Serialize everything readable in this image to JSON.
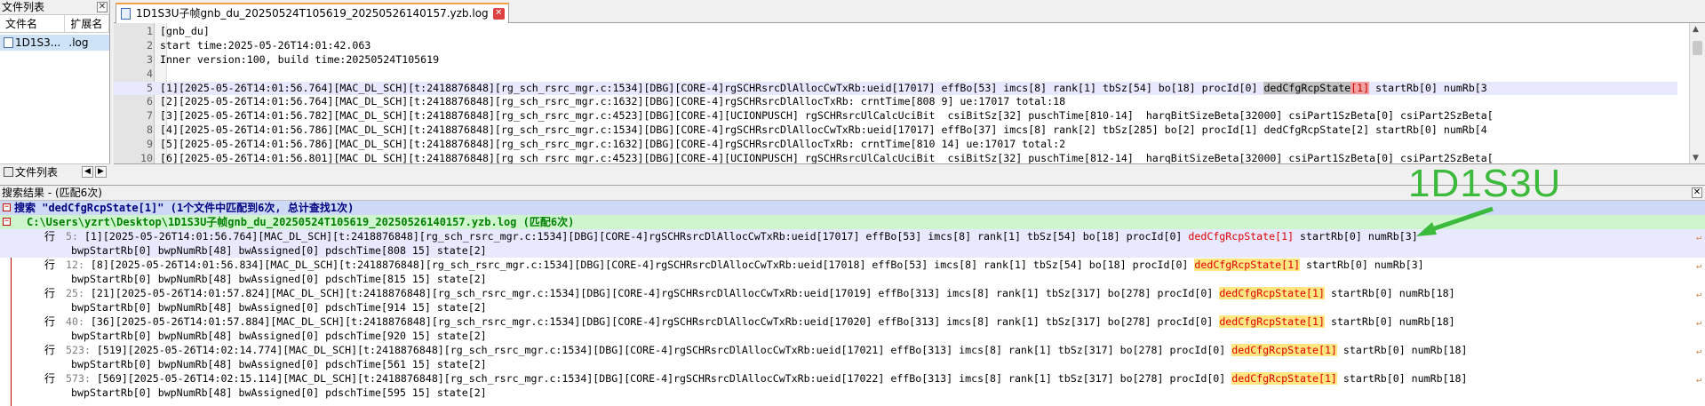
{
  "file_list_panel": {
    "title": "文件列表",
    "columns": [
      "文件名",
      "扩展名"
    ],
    "rows": [
      {
        "name": "1D1S3...",
        "ext": ".log"
      }
    ],
    "bottom_tab": "文件列表"
  },
  "editor": {
    "tab_title": "1D1S3U子帧gnb_du_20250524T105619_20250526140157.yzb.log",
    "lines": [
      {
        "n": "1",
        "t": "[gnb_du]"
      },
      {
        "n": "2",
        "t": "start time:2025-05-26T14:01:42.063"
      },
      {
        "n": "3",
        "t": "Inner version:100, build time:20250524T105619"
      },
      {
        "n": "4",
        "t": ""
      },
      {
        "n": "5",
        "pre": "[1][2025-05-26T14:01:56.764][MAC_DL_SCH][t:2418876848][rg_sch_rsrc_mgr.c:1534][DBG][CORE-4]rgSCHRsrcDlAllocCwTxRb:ueid[17017] effBo[53] imcs[8] rank[1] tbSz[54] bo[18] procId[0] ",
        "sel": "dedCfgRcpState",
        "br": "[1]",
        "post": " startRb[0] numRb[3"
      },
      {
        "n": "6",
        "t": "[2][2025-05-26T14:01:56.764][MAC_DL_SCH][t:2418876848][rg_sch_rsrc_mgr.c:1632][DBG][CORE-4]rgSCHRsrcDlAllocTxRb: crntTime[808 9] ue:17017 total:18"
      },
      {
        "n": "7",
        "t": "[3][2025-05-26T14:01:56.782][MAC_DL_SCH][t:2418876848][rg_sch_rsrc_mgr.c:4523][DBG][CORE-4][UCIONPUSCH] rgSCHRsrcUlCalcUciBit  csiBitSz[32] puschTime[810-14]  harqBitSizeBeta[32000] csiPart1SzBeta[0] csiPart2SzBeta["
      },
      {
        "n": "8",
        "t": "[4][2025-05-26T14:01:56.786][MAC_DL_SCH][t:2418876848][rg_sch_rsrc_mgr.c:1534][DBG][CORE-4]rgSCHRsrcDlAllocCwTxRb:ueid[17017] effBo[37] imcs[8] rank[2] tbSz[285] bo[2] procId[1] dedCfgRcpState[2] startRb[0] numRb[4"
      },
      {
        "n": "9",
        "t": "[5][2025-05-26T14:01:56.786][MAC_DL_SCH][t:2418876848][rg_sch_rsrc_mgr.c:1632][DBG][CORE-4]rgSCHRsrcDlAllocTxRb: crntTime[810 14] ue:17017 total:2"
      },
      {
        "n": "10",
        "t": "[6][2025-05-26T14:01:56.801][MAC_DL_SCH][t:2418876848][rg_sch_rsrc_mgr.c:4523][DBG][CORE-4][UCIONPUSCH] rgSCHRsrcUlCalcUciBit  csiBitSz[32] puschTime[812-14]  harqBitSizeBeta[32000] csiPart1SzBeta[0] csiPart2SzBeta["
      }
    ]
  },
  "results": {
    "title": "搜索结果 - (匹配6次)",
    "search_line": "搜索 \"dedCfgRcpState[1]\" (1个文件中匹配到6次, 总计查找1次)",
    "file_line": "C:\\Users\\yzrt\\Desktop\\1D1S3U子帧gnb_du_20250524T105619_20250526140157.yzb.log  (匹配6次)",
    "row_label": "行",
    "hits": [
      {
        "lno": "5:",
        "pre": " [1][2025-05-26T14:01:56.764][MAC_DL_SCH][t:2418876848][rg_sch_rsrc_mgr.c:1534][DBG][CORE-4]rgSCHRsrcDlAllocCwTxRb:ueid[17017] effBo[53] imcs[8] rank[1] tbSz[54] bo[18] procId[0] ",
        "match": "dedCfgRcpState[1]",
        "post": " startRb[0] numRb[3]",
        "cont": "bwpStartRb[0] bwpNumRb[48] bwAssigned[0] pdschTime[808 15] state[2]"
      },
      {
        "lno": "12:",
        "pre": " [8][2025-05-26T14:01:56.834][MAC_DL_SCH][t:2418876848][rg_sch_rsrc_mgr.c:1534][DBG][CORE-4]rgSCHRsrcDlAllocCwTxRb:ueid[17018] effBo[53] imcs[8] rank[1] tbSz[54] bo[18] procId[0] ",
        "match": "dedCfgRcpState[1]",
        "post": " startRb[0] numRb[3]",
        "cont": "bwpStartRb[0] bwpNumRb[48] bwAssigned[0] pdschTime[815 15] state[2]"
      },
      {
        "lno": "25:",
        "pre": " [21][2025-05-26T14:01:57.824][MAC_DL_SCH][t:2418876848][rg_sch_rsrc_mgr.c:1534][DBG][CORE-4]rgSCHRsrcDlAllocCwTxRb:ueid[17019] effBo[313] imcs[8] rank[1] tbSz[317] bo[278] procId[0] ",
        "match": "dedCfgRcpState[1]",
        "post": " startRb[0] numRb[18]",
        "cont": "bwpStartRb[0] bwpNumRb[48] bwAssigned[0] pdschTime[914 15] state[2]"
      },
      {
        "lno": "40:",
        "pre": " [36][2025-05-26T14:01:57.884][MAC_DL_SCH][t:2418876848][rg_sch_rsrc_mgr.c:1534][DBG][CORE-4]rgSCHRsrcDlAllocCwTxRb:ueid[17020] effBo[313] imcs[8] rank[1] tbSz[317] bo[278] procId[0] ",
        "match": "dedCfgRcpState[1]",
        "post": " startRb[0] numRb[18]",
        "cont": "bwpStartRb[0] bwpNumRb[48] bwAssigned[0] pdschTime[920 15] state[2]"
      },
      {
        "lno": "523:",
        "pre": " [519][2025-05-26T14:02:14.774][MAC_DL_SCH][t:2418876848][rg_sch_rsrc_mgr.c:1534][DBG][CORE-4]rgSCHRsrcDlAllocCwTxRb:ueid[17021] effBo[313] imcs[8] rank[1] tbSz[317] bo[278] procId[0] ",
        "match": "dedCfgRcpState[1]",
        "post": " startRb[0] numRb[18]",
        "cont": "bwpStartRb[0] bwpNumRb[48] bwAssigned[0] pdschTime[561 15] state[2]"
      },
      {
        "lno": "573:",
        "pre": " [569][2025-05-26T14:02:15.114][MAC_DL_SCH][t:2418876848][rg_sch_rsrc_mgr.c:1534][DBG][CORE-4]rgSCHRsrcDlAllocCwTxRb:ueid[17022] effBo[313] imcs[8] rank[1] tbSz[317] bo[278] procId[0] ",
        "match": "dedCfgRcpState[1]",
        "post": " startRb[0] numRb[18]",
        "cont": "bwpStartRb[0] bwpNumRb[48] bwAssigned[0] pdschTime[595 15] state[2]"
      }
    ]
  },
  "annotation": {
    "text": "1D1S3U",
    "color": "#3cba3c"
  },
  "colors": {
    "match_bg": "#ffe680",
    "match_fg": "#e00000",
    "search_bg": "#cdd9f7",
    "file_bg": "#cff5cf"
  }
}
